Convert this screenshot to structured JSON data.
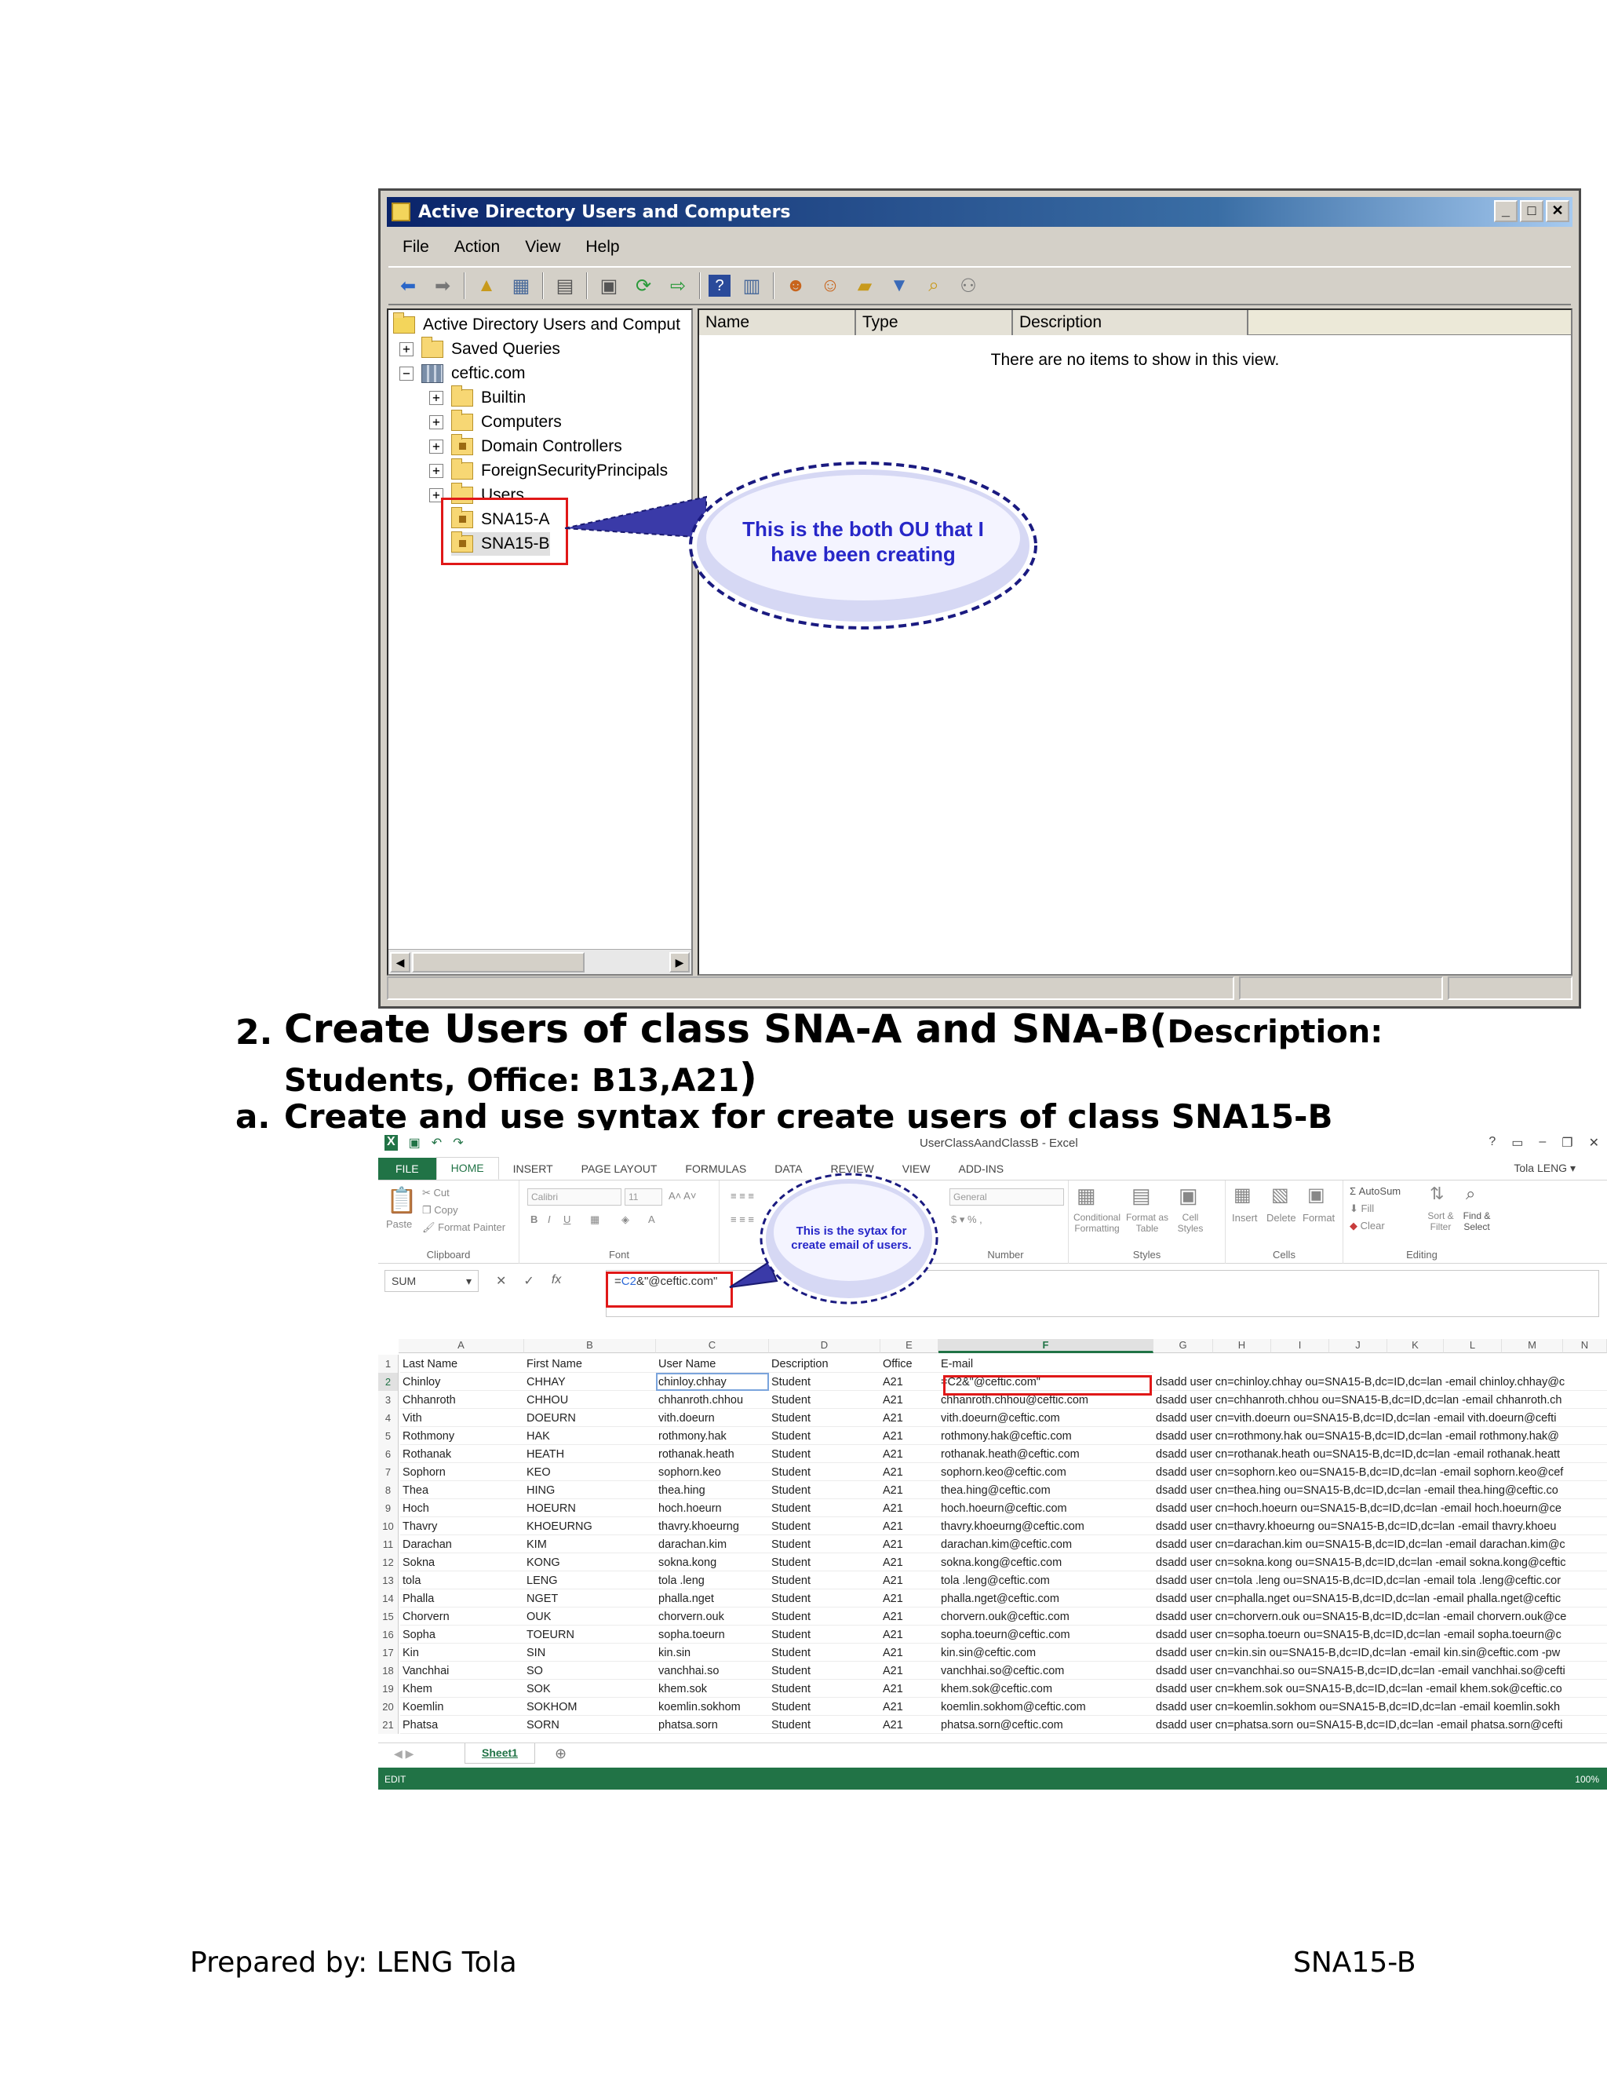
{
  "ad": {
    "title": "Active Directory Users and Computers",
    "menu": [
      "File",
      "Action",
      "View",
      "Help"
    ],
    "tree": {
      "root": "Active Directory Users and Comput",
      "saved_queries": "Saved Queries",
      "domain": "ceftic.com",
      "children": [
        "Builtin",
        "Computers",
        "Domain Controllers",
        "ForeignSecurityPrincipals",
        "Users"
      ],
      "ous": [
        "SNA15-A",
        "SNA15-B"
      ]
    },
    "columns": [
      "Name",
      "Type",
      "Description"
    ],
    "empty_message": "There are no items to show in this view.",
    "callout": "This is the both OU that I have been creating"
  },
  "heading2": {
    "number": "2.",
    "title": "Create Users of class SNA-A and SNA-B(",
    "desc_label": "Description:",
    "line2": "Students, Office: B13,A21",
    "close_paren": ")"
  },
  "heading_a": {
    "number": "a.",
    "text": "Create and use syntax for create users of class SNA15-B"
  },
  "excel": {
    "window_title": "UserClassAandClassB - Excel",
    "tabs": [
      "FILE",
      "HOME",
      "INSERT",
      "PAGE LAYOUT",
      "FORMULAS",
      "DATA",
      "REVIEW",
      "VIEW",
      "ADD-INS"
    ],
    "active_tab": "HOME",
    "user": "Tola LENG",
    "ribbon": {
      "paste": "Paste",
      "cut": "Cut",
      "copy": "Copy",
      "format_painter": "Format Painter",
      "clipboard": "Clipboard",
      "font_name": "Calibri",
      "font_size": "11",
      "font": "Font",
      "number_format": "General",
      "number": "Number",
      "conditional_formatting": "Conditional Formatting",
      "format_as_table": "Format as Table",
      "cell_styles": "Cell Styles",
      "styles": "Styles",
      "insert": "Insert",
      "delete": "Delete",
      "format": "Format",
      "cells": "Cells",
      "autosum": "AutoSum",
      "fill": "Fill",
      "clear": "Clear",
      "sort_filter": "Sort & Filter",
      "find_select": "Find & Select",
      "editing": "Editing"
    },
    "name_box": "SUM",
    "formula_prefix": "=",
    "formula_ref": "C2",
    "formula_rest": "&\"@ceftic.com\"",
    "callout": "This is the sytax for create email of users.",
    "column_letters": [
      "A",
      "B",
      "C",
      "D",
      "E",
      "F",
      "G",
      "H",
      "I",
      "J",
      "K",
      "L",
      "M",
      "N"
    ],
    "header_row": [
      "Last Name",
      "First Name",
      "User Name",
      "Description",
      "Office",
      "E-mail"
    ],
    "rows": [
      [
        "Chinloy",
        "CHHAY",
        "chinloy.chhay",
        "Student",
        "A21",
        "=C2&\"@ceftic.com\"",
        "dsadd user cn=chinloy.chhay ou=SNA15-B,dc=ID,dc=lan -email chinloy.chhay@c"
      ],
      [
        "Chhanroth",
        "CHHOU",
        "chhanroth.chhou",
        "Student",
        "A21",
        "chhanroth.chhou@ceftic.com",
        "dsadd user cn=chhanroth.chhou ou=SNA15-B,dc=ID,dc=lan -email chhanroth.ch"
      ],
      [
        "Vith",
        "DOEURN",
        "vith.doeurn",
        "Student",
        "A21",
        "vith.doeurn@ceftic.com",
        "dsadd user cn=vith.doeurn ou=SNA15-B,dc=ID,dc=lan -email vith.doeurn@cefti"
      ],
      [
        "Rothmony",
        "HAK",
        "rothmony.hak",
        "Student",
        "A21",
        "rothmony.hak@ceftic.com",
        "dsadd user cn=rothmony.hak ou=SNA15-B,dc=ID,dc=lan -email rothmony.hak@"
      ],
      [
        "Rothanak",
        "HEATH",
        "rothanak.heath",
        "Student",
        "A21",
        "rothanak.heath@ceftic.com",
        "dsadd user cn=rothanak.heath ou=SNA15-B,dc=ID,dc=lan -email rothanak.heatt"
      ],
      [
        "Sophorn",
        "KEO",
        "sophorn.keo",
        "Student",
        "A21",
        "sophorn.keo@ceftic.com",
        "dsadd user cn=sophorn.keo ou=SNA15-B,dc=ID,dc=lan -email sophorn.keo@cef"
      ],
      [
        "Thea",
        "HING",
        "thea.hing",
        "Student",
        "A21",
        "thea.hing@ceftic.com",
        "dsadd user cn=thea.hing ou=SNA15-B,dc=ID,dc=lan -email thea.hing@ceftic.co"
      ],
      [
        "Hoch",
        "HOEURN",
        "hoch.hoeurn",
        "Student",
        "A21",
        "hoch.hoeurn@ceftic.com",
        "dsadd user cn=hoch.hoeurn ou=SNA15-B,dc=ID,dc=lan -email hoch.hoeurn@ce"
      ],
      [
        "Thavry",
        "KHOEURNG",
        "thavry.khoeurng",
        "Student",
        "A21",
        "thavry.khoeurng@ceftic.com",
        "dsadd user cn=thavry.khoeurng ou=SNA15-B,dc=ID,dc=lan -email thavry.khoeu"
      ],
      [
        "Darachan",
        "KIM",
        "darachan.kim",
        "Student",
        "A21",
        "darachan.kim@ceftic.com",
        "dsadd user cn=darachan.kim ou=SNA15-B,dc=ID,dc=lan -email darachan.kim@c"
      ],
      [
        "Sokna",
        "KONG",
        "sokna.kong",
        "Student",
        "A21",
        "sokna.kong@ceftic.com",
        "dsadd user cn=sokna.kong ou=SNA15-B,dc=ID,dc=lan -email sokna.kong@ceftic"
      ],
      [
        "tola",
        "LENG",
        "tola .leng",
        "Student",
        "A21",
        "tola .leng@ceftic.com",
        "dsadd user cn=tola .leng ou=SNA15-B,dc=ID,dc=lan -email tola .leng@ceftic.cor"
      ],
      [
        "Phalla",
        "NGET",
        "phalla.nget",
        "Student",
        "A21",
        "phalla.nget@ceftic.com",
        "dsadd user cn=phalla.nget ou=SNA15-B,dc=ID,dc=lan -email phalla.nget@ceftic"
      ],
      [
        "Chorvern",
        "OUK",
        "chorvern.ouk",
        "Student",
        "A21",
        "chorvern.ouk@ceftic.com",
        "dsadd user cn=chorvern.ouk ou=SNA15-B,dc=ID,dc=lan -email chorvern.ouk@ce"
      ],
      [
        "Sopha",
        "TOEURN",
        "sopha.toeurn",
        "Student",
        "A21",
        "sopha.toeurn@ceftic.com",
        "dsadd user cn=sopha.toeurn ou=SNA15-B,dc=ID,dc=lan -email sopha.toeurn@c"
      ],
      [
        "Kin",
        "SIN",
        "kin.sin",
        "Student",
        "A21",
        "kin.sin@ceftic.com",
        "dsadd user cn=kin.sin ou=SNA15-B,dc=ID,dc=lan -email kin.sin@ceftic.com -pw"
      ],
      [
        "Vanchhai",
        "SO",
        "vanchhai.so",
        "Student",
        "A21",
        "vanchhai.so@ceftic.com",
        "dsadd user cn=vanchhai.so ou=SNA15-B,dc=ID,dc=lan -email vanchhai.so@cefti"
      ],
      [
        "Khem",
        "SOK",
        "khem.sok",
        "Student",
        "A21",
        "khem.sok@ceftic.com",
        "dsadd user cn=khem.sok ou=SNA15-B,dc=ID,dc=lan -email khem.sok@ceftic.co"
      ],
      [
        "Koemlin",
        "SOKHOM",
        "koemlin.sokhom",
        "Student",
        "A21",
        "koemlin.sokhom@ceftic.com",
        "dsadd user cn=koemlin.sokhom ou=SNA15-B,dc=ID,dc=lan -email koemlin.sokh"
      ],
      [
        "Phatsa",
        "SORN",
        "phatsa.sorn",
        "Student",
        "A21",
        "phatsa.sorn@ceftic.com",
        "dsadd user cn=phatsa.sorn ou=SNA15-B,dc=ID,dc=lan -email phatsa.sorn@cefti"
      ]
    ],
    "sheet_tab": "Sheet1",
    "status_mode": "EDIT",
    "zoom": "100%"
  },
  "footer": {
    "left": "Prepared by: LENG Tola",
    "right": "SNA15-B"
  }
}
